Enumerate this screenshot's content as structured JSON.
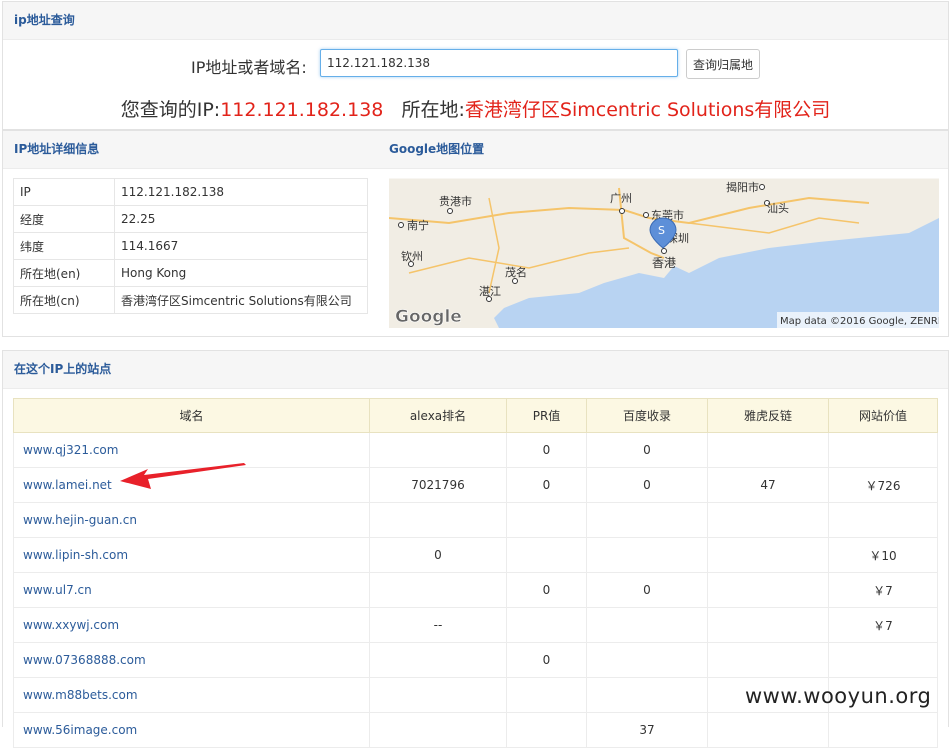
{
  "query_panel": {
    "title": "ip地址查询",
    "label": "IP地址或者域名:",
    "input_value": "112.121.182.138",
    "button_label": "查询归属地",
    "result_prefix": "您查询的IP:",
    "result_ip": "112.121.182.138",
    "result_location_label": "所在地:",
    "result_location": "香港湾仔区Simcentric Solutions有限公司"
  },
  "detail_panel": {
    "left_title": "IP地址详细信息",
    "right_title": "Google地图位置",
    "rows": [
      {
        "key": "IP",
        "value": "112.121.182.138"
      },
      {
        "key": "经度",
        "value": "22.25"
      },
      {
        "key": "纬度",
        "value": "114.1667"
      },
      {
        "key": "所在地(en)",
        "value": "Hong Kong"
      },
      {
        "key": "所在地(cn)",
        "value": "香港湾仔区Simcentric Solutions有限公司"
      }
    ],
    "map": {
      "cities": [
        "贵港市",
        "广州",
        "东莞市",
        "揭阳市",
        "汕头",
        "南宁",
        "深圳",
        "香港",
        "钦州",
        "茂名",
        "湛江"
      ],
      "marker": "S",
      "logo": "Google",
      "attribution": "Map data ©2016 Google, ZENRIN"
    }
  },
  "sites_panel": {
    "title": "在这个IP上的站点",
    "columns": [
      "域名",
      "alexa排名",
      "PR值",
      "百度收录",
      "雅虎反链",
      "网站价值"
    ],
    "rows": [
      [
        "www.qj321.com",
        "",
        "0",
        "0",
        "",
        ""
      ],
      [
        "www.lamei.net",
        "7021796",
        "0",
        "0",
        "47",
        "￥726"
      ],
      [
        "www.hejin-guan.cn",
        "",
        "",
        "",
        "",
        ""
      ],
      [
        "www.lipin-sh.com",
        "0",
        "",
        "",
        "",
        "￥10"
      ],
      [
        "www.ul7.cn",
        "",
        "0",
        "0",
        "",
        "￥7"
      ],
      [
        "www.xxywj.com",
        "--",
        "",
        "",
        "",
        "￥7"
      ],
      [
        "www.07368888.com",
        "",
        "0",
        "",
        "",
        ""
      ],
      [
        "www.m88bets.com",
        "",
        "",
        "",
        "",
        ""
      ],
      [
        "www.56image.com",
        "",
        "",
        "37",
        "",
        ""
      ]
    ]
  },
  "watermark": "www.wooyun.org",
  "colors": {
    "link": "#2b5b9a",
    "result_red": "#e2231a",
    "header_bg": "#fcf8e3"
  }
}
